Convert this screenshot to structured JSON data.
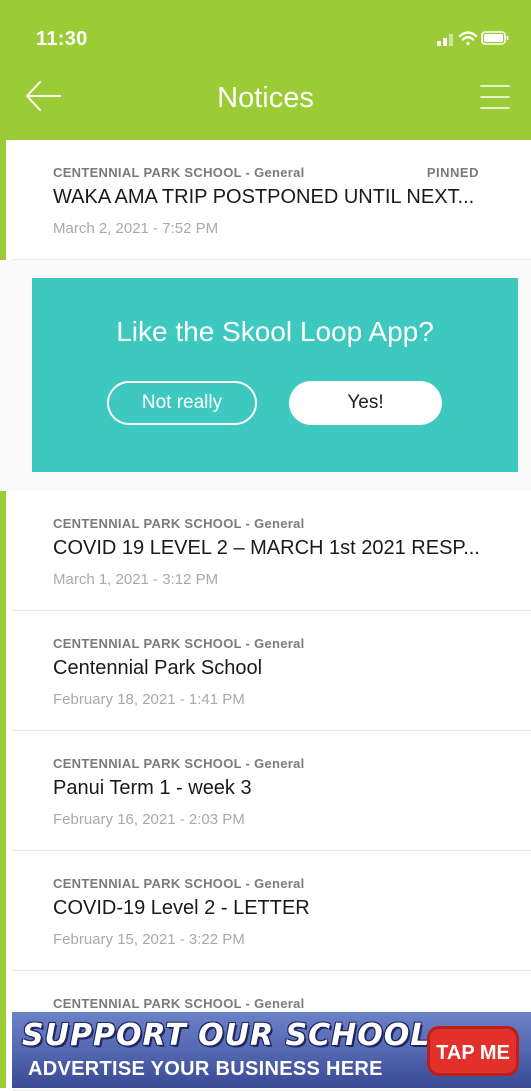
{
  "status_bar": {
    "time": "11:30"
  },
  "nav": {
    "title": "Notices"
  },
  "notices": [
    {
      "category": "CENTENNIAL PARK SCHOOL - General",
      "pinned": "PINNED",
      "title": "WAKA AMA TRIP POSTPONED UNTIL NEXT...",
      "date": "March 2, 2021 - 7:52 PM"
    },
    {
      "category": "CENTENNIAL PARK SCHOOL - General",
      "title": "COVID 19 LEVEL 2 – MARCH 1st 2021 RESP...",
      "date": "March 1, 2021 - 3:12 PM"
    },
    {
      "category": "CENTENNIAL PARK SCHOOL - General",
      "title": "Centennial Park School",
      "date": "February 18, 2021 - 1:41 PM"
    },
    {
      "category": "CENTENNIAL PARK SCHOOL - General",
      "title": "Panui Term 1 - week 3",
      "date": "February 16, 2021 - 2:03 PM"
    },
    {
      "category": "CENTENNIAL PARK SCHOOL - General",
      "title": "COVID-19 Level 2 - LETTER",
      "date": "February 15, 2021 - 3:22 PM"
    },
    {
      "category": "CENTENNIAL PARK SCHOOL - General"
    }
  ],
  "promo": {
    "title": "Like the Skool Loop App?",
    "no_label": "Not really",
    "yes_label": "Yes!"
  },
  "ad_banner": {
    "line1": "SUPPORT OUR SCHOOL...",
    "line2": "ADVERTISE YOUR BUSINESS HERE",
    "tap_label": "TAP ME"
  },
  "colors": {
    "header": "#9bcb35",
    "accent": "#9bcb35",
    "promo": "#3ec9c0"
  },
  "icons": [
    "back-arrow-icon",
    "hamburger-menu-icon",
    "signal-icon",
    "wifi-icon",
    "battery-icon"
  ]
}
